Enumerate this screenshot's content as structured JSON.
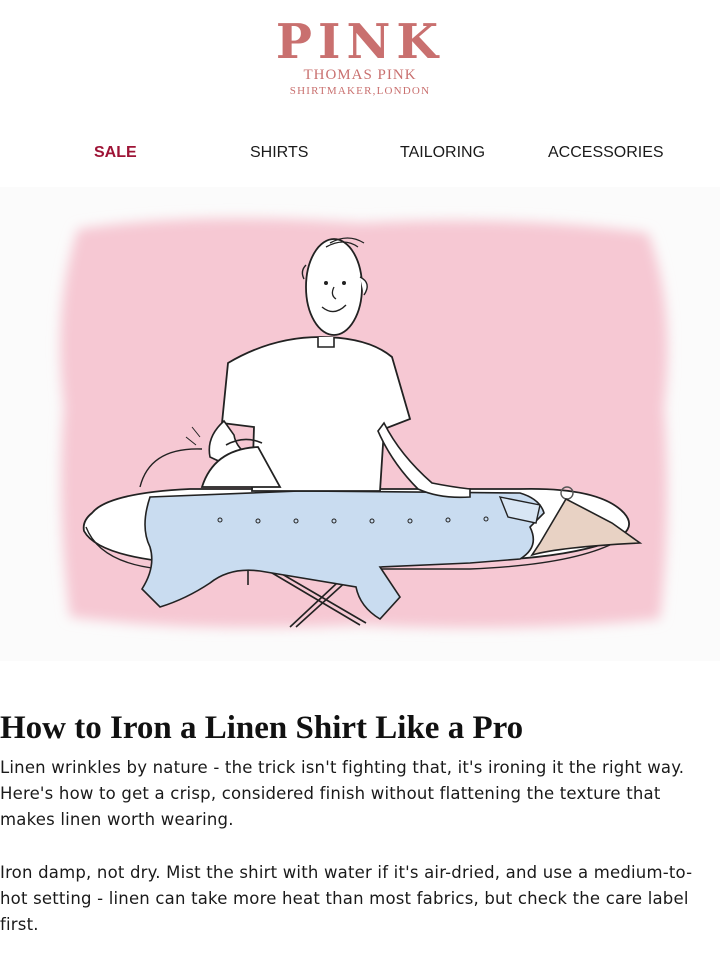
{
  "brand": {
    "logo": "PINK",
    "name": "THOMAS PINK",
    "tagline": "SHIRTMAKER,LONDON",
    "color": "#c9706f"
  },
  "nav": {
    "items": [
      {
        "label": "SALE",
        "highlight": true,
        "color": "#9e1436"
      },
      {
        "label": "SHIRTS"
      },
      {
        "label": "TAILORING"
      },
      {
        "label": "ACCESSORIES"
      }
    ]
  },
  "hero": {
    "background_color": "#f6c8d3"
  },
  "article": {
    "title": "How to Iron a Linen Shirt Like a Pro",
    "paragraphs": [
      "Linen wrinkles by nature - the trick isn't fighting that, it's ironing it the right way. Here's how to get a crisp, considered finish without flattening the texture that makes linen worth wearing.",
      "Iron damp, not dry. Mist the shirt with water if it's air-dried, and use a medium-to-hot setting - linen can take more heat than most fabrics, but check the care label first."
    ]
  }
}
